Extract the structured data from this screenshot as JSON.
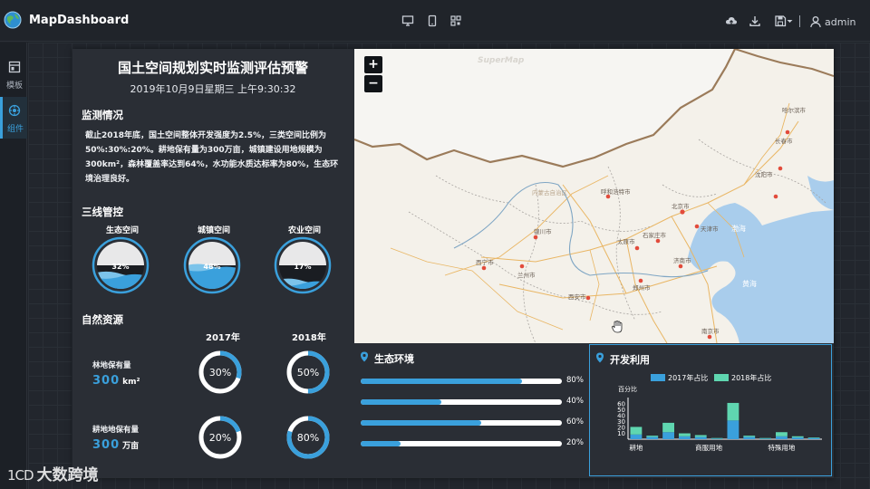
{
  "app": {
    "title": "MapDashboard",
    "user": "admin"
  },
  "toolbar": {
    "device_icons": [
      "desktop-icon",
      "tablet-icon",
      "qrcode-icon"
    ],
    "action_icons": [
      "upload-cloud-icon",
      "download-icon",
      "save-icon",
      "user-icon"
    ]
  },
  "sidenav": {
    "items": [
      {
        "label": "模板",
        "icon": "template-icon",
        "active": false
      },
      {
        "label": "组件",
        "icon": "component-icon",
        "active": true
      }
    ]
  },
  "dashboard": {
    "title": "国土空间规划实时监测评估预警",
    "datetime": "2019年10月9日星期三 上午9:30:32",
    "monitoring": {
      "heading": "监测情况",
      "text": "截止2018年底，国土空间整体开发强度为2.5%，三类空间比例为50%:30%:20%。耕地保有量为300万亩，城镇建设用地规模为300km²，森林覆盖率达到64%，水功能水质达标率为80%，生态环境治理良好。"
    },
    "three_lines": {
      "heading": "三线管控",
      "items": [
        {
          "label": "生态空间",
          "value": "32%",
          "fraction": 0.32
        },
        {
          "label": "城镇空间",
          "value": "48%",
          "fraction": 0.48
        },
        {
          "label": "农业空间",
          "value": "17%",
          "fraction": 0.17
        }
      ]
    },
    "natural_resources": {
      "heading": "自然资源",
      "col_2017": "2017年",
      "col_2018": "2018年",
      "rows": [
        {
          "name": "林地保有量",
          "value": "300",
          "unit": "km²",
          "y2017": "30%",
          "f2017": 0.3,
          "y2018": "50%",
          "f2018": 0.5
        },
        {
          "name": "耕地地保有量",
          "value": "300",
          "unit": "万亩",
          "y2017": "20%",
          "f2017": 0.2,
          "y2018": "80%",
          "f2018": 0.8
        }
      ]
    }
  },
  "map": {
    "zoom_in": "+",
    "zoom_out": "−",
    "watermark": "SuperMap",
    "cities": [
      "哈尔滨市",
      "长春市",
      "沈阳市",
      "呼和浩特市",
      "北京市",
      "天津市",
      "太原市",
      "石家庄市",
      "银川市",
      "兰州市",
      "西宁市",
      "西安市",
      "郑州市",
      "济南市",
      "南京市",
      "内蒙古自治区"
    ],
    "seas": [
      "渤海",
      "黄海"
    ]
  },
  "eco": {
    "heading": "生态环境",
    "bars": [
      {
        "value": "80%",
        "fraction": 0.8
      },
      {
        "value": "40%",
        "fraction": 0.4
      },
      {
        "value": "60%",
        "fraction": 0.6
      },
      {
        "value": "20%",
        "fraction": 0.2
      }
    ]
  },
  "dev": {
    "heading": "开发利用"
  },
  "chart_data": {
    "type": "bar",
    "stacked": true,
    "ylabel": "百分比",
    "yticks": [
      10,
      20,
      30,
      40,
      50,
      60
    ],
    "ylim": [
      0,
      65
    ],
    "x_tick_labels": [
      "耕地",
      "商服用地",
      "特殊用地"
    ],
    "categories": [
      "",
      "",
      "",
      "",
      "",
      "",
      "",
      "",
      "",
      "",
      "",
      ""
    ],
    "series": [
      {
        "name": "2017年占比",
        "color": "#3aa0dc",
        "values": [
          8,
          4,
          12,
          5,
          4,
          1,
          32,
          4,
          1,
          5,
          3,
          2
        ]
      },
      {
        "name": "2018年占比",
        "color": "#5fd6b0",
        "values": [
          13,
          2,
          16,
          5,
          3,
          1,
          30,
          2,
          1,
          7,
          2,
          1
        ]
      }
    ],
    "legend": "top",
    "grid": false
  },
  "watermark": {
    "mark": "1CD",
    "text": "大数跨境"
  }
}
